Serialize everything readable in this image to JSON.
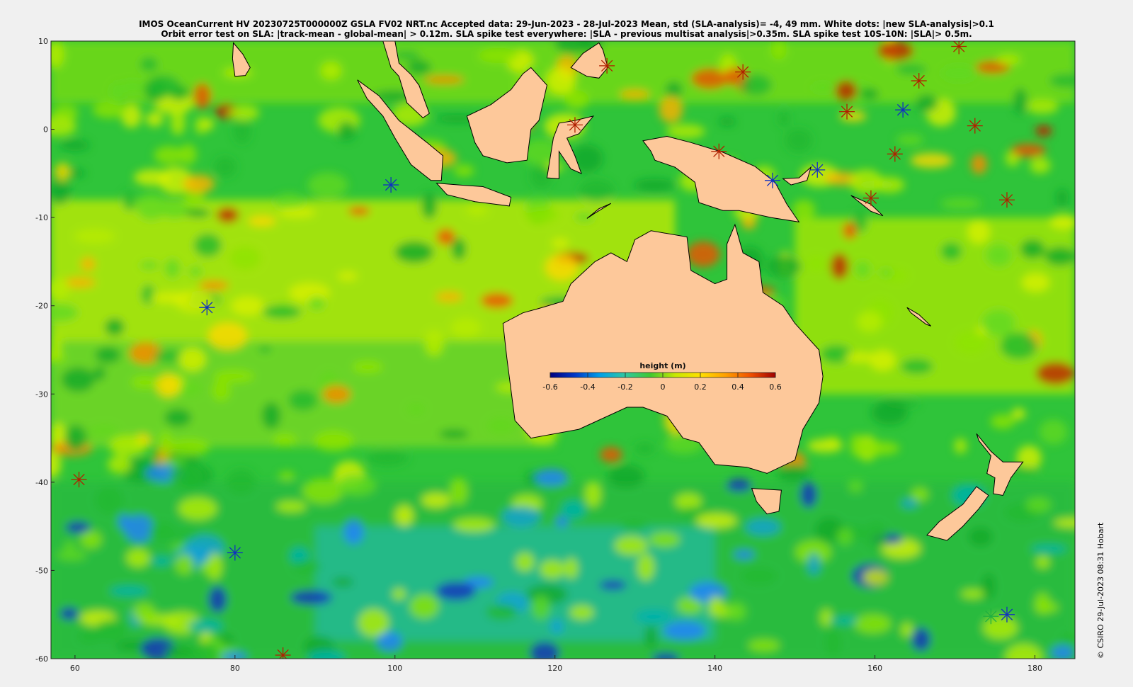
{
  "title": {
    "line1": "IMOS OceanCurrent HV 20230725T000000Z GSLA FV02 NRT.nc  Accepted data: 29-Jun-2023 - 28-Jul-2023 Mean, std (SLA-analysis)= -4, 49 mm. White dots: |new SLA-analysis|>0.1",
    "line2": "Orbit error test on SLA: |track-mean  - global-mean| > 0.12m.  SLA spike test everywhere: |SLA - previous multisat analysis|>0.35m. SLA spike test 10S-10N: |SLA|> 0.5m."
  },
  "credit": "© CSIRO 29-Jul-2023 08:31 Hobart",
  "map": {
    "lon_range": [
      57,
      185
    ],
    "lat_range": [
      -60,
      10
    ],
    "x_ticks": [
      "60",
      "80",
      "100",
      "120",
      "140",
      "160",
      "180"
    ],
    "x_tick_values": [
      60,
      80,
      100,
      120,
      140,
      160,
      180
    ],
    "y_ticks": [
      "10",
      "0",
      "-10",
      "-20",
      "-30",
      "-40",
      "-50",
      "-60"
    ],
    "y_tick_values": [
      10,
      0,
      -10,
      -20,
      -30,
      -40,
      -50,
      -60
    ],
    "land_color": "#fdc89a",
    "ocean_base_color": "#2fc43a"
  },
  "colorbar": {
    "title": "height (m)",
    "ticks": [
      "-0.6",
      "-0.4",
      "-0.2",
      "0",
      "0.2",
      "0.4",
      "0.6"
    ],
    "colors": [
      "#00007f",
      "#0038c8",
      "#00a0e8",
      "#30c8a0",
      "#40c830",
      "#c8e800",
      "#ffe000",
      "#ffa000",
      "#f05000",
      "#a00000"
    ]
  },
  "markers": [
    {
      "lon": 76.5,
      "lat": -20.2,
      "color": "#1030c0"
    },
    {
      "lon": 60.5,
      "lat": -39.7,
      "color": "#b02000"
    },
    {
      "lon": 99.5,
      "lat": -6.3,
      "color": "#1030c0"
    },
    {
      "lon": 126.5,
      "lat": 7.2,
      "color": "#b02000"
    },
    {
      "lon": 122.5,
      "lat": 0.5,
      "color": "#b02000"
    },
    {
      "lon": 143.5,
      "lat": 6.5,
      "color": "#b02000"
    },
    {
      "lon": 140.5,
      "lat": -2.5,
      "color": "#b02000"
    },
    {
      "lon": 147.2,
      "lat": -5.8,
      "color": "#1030c0"
    },
    {
      "lon": 152.8,
      "lat": -4.6,
      "color": "#1030c0"
    },
    {
      "lon": 156.5,
      "lat": 2.0,
      "color": "#b02000"
    },
    {
      "lon": 163.5,
      "lat": 2.2,
      "color": "#1030c0"
    },
    {
      "lon": 165.5,
      "lat": 5.5,
      "color": "#b02000"
    },
    {
      "lon": 170.5,
      "lat": 9.4,
      "color": "#b02000"
    },
    {
      "lon": 172.5,
      "lat": 0.4,
      "color": "#b02000"
    },
    {
      "lon": 176.5,
      "lat": -8.0,
      "color": "#b02000"
    },
    {
      "lon": 162.5,
      "lat": -2.8,
      "color": "#b02000"
    },
    {
      "lon": 159.5,
      "lat": -7.8,
      "color": "#b02000"
    },
    {
      "lon": 80.0,
      "lat": -48.0,
      "color": "#1030c0"
    },
    {
      "lon": 86.0,
      "lat": -59.6,
      "color": "#b02000"
    },
    {
      "lon": 174.5,
      "lat": -55.2,
      "color": "#20b040"
    },
    {
      "lon": 176.5,
      "lat": -55.0,
      "color": "#1030c0"
    }
  ]
}
